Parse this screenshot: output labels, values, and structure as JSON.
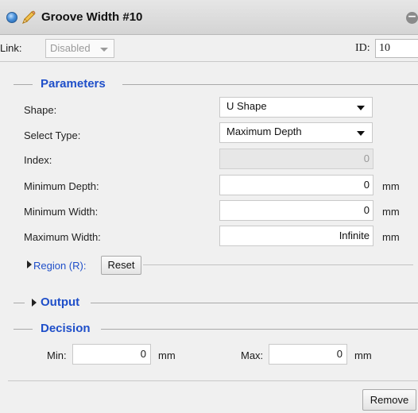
{
  "window": {
    "title": "Groove Width #10",
    "collapse_glyph": "−"
  },
  "link_row": {
    "link_label": "Link:",
    "link_value": "Disabled",
    "id_label": "ID:",
    "id_value": "10"
  },
  "parameters": {
    "title": "Parameters",
    "shape": {
      "label": "Shape:",
      "value": "U Shape"
    },
    "select_type": {
      "label": "Select Type:",
      "value": "Maximum Depth"
    },
    "index": {
      "label": "Index:",
      "value": "0"
    },
    "minimum_depth": {
      "label": "Minimum Depth:",
      "value": "0",
      "unit": "mm"
    },
    "minimum_width": {
      "label": "Minimum Width:",
      "value": "0",
      "unit": "mm"
    },
    "maximum_width": {
      "label": "Maximum Width:",
      "value": "Infinite",
      "unit": "mm"
    },
    "region": {
      "label": "Region (R):",
      "reset_label": "Reset"
    }
  },
  "output": {
    "title": "Output"
  },
  "decision": {
    "title": "Decision",
    "min_label": "Min:",
    "min_value": "0",
    "min_unit": "mm",
    "max_label": "Max:",
    "max_value": "0",
    "max_unit": "mm"
  },
  "footer": {
    "remove_label": "Remove"
  },
  "colors": {
    "section_title": "#1f4fc9",
    "background": "#f0f0f0"
  },
  "icons": [
    "status-dot-icon",
    "pencil-icon",
    "collapse-icon",
    "chevron-down-icon",
    "triangle-right-icon"
  ]
}
